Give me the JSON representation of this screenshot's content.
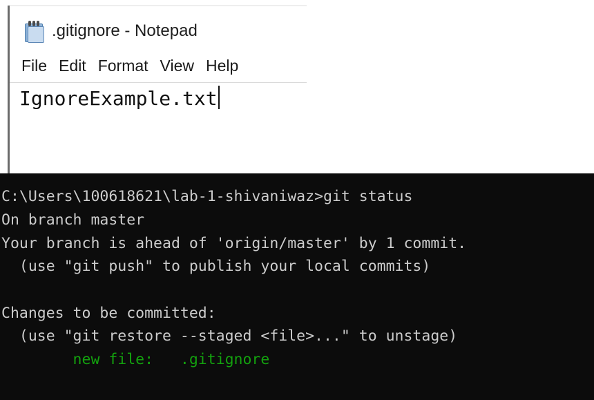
{
  "notepad": {
    "title": ".gitignore - Notepad",
    "icon": "notepad-icon",
    "menu": [
      "File",
      "Edit",
      "Format",
      "View",
      "Help"
    ],
    "content": "IgnoreExample.txt"
  },
  "terminal": {
    "lines": [
      "C:\\Users\\100618621\\lab-1-shivaniwaz>git status",
      "On branch master",
      "Your branch is ahead of 'origin/master' by 1 commit.",
      "  (use \"git push\" to publish your local commits)",
      "",
      "Changes to be committed:",
      "  (use \"git restore --staged <file>...\" to unstage)",
      "        new file:   .gitignore"
    ],
    "highlight_color": "#13a10e",
    "text_color": "#cccccc",
    "background": "#0c0c0c"
  }
}
